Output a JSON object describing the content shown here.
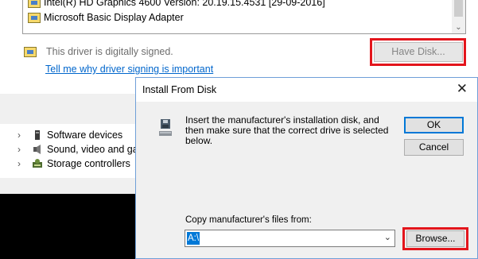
{
  "driver_list": {
    "items": [
      {
        "label": "Intel(R) HD Graphics 4600 Version: 20.19.15.4531 [29-09-2016]"
      },
      {
        "label": "Microsoft Basic Display Adapter"
      }
    ],
    "scroll_down_icon": "chevron-down"
  },
  "signature": {
    "status": "This driver is digitally signed.",
    "link": "Tell me why driver signing is important"
  },
  "buttons": {
    "have_disk": "Have Disk..."
  },
  "device_tree": {
    "items": [
      {
        "label": "Software devices",
        "icon": "chip-icon"
      },
      {
        "label": "Sound, video and game controllers",
        "icon": "speaker-icon"
      },
      {
        "label": "Storage controllers",
        "icon": "storage-icon"
      }
    ]
  },
  "install_dialog": {
    "title": "Install From Disk",
    "instruction": "Insert the manufacturer's installation disk, and then make sure that the correct drive is selected below.",
    "ok": "OK",
    "cancel": "Cancel",
    "copy_label": "Copy manufacturer's files from:",
    "path_value": "A:\\",
    "browse": "Browse..."
  },
  "colors": {
    "highlight_red": "#e3151c",
    "link_blue": "#0066cc",
    "selection_blue": "#0078d7"
  }
}
